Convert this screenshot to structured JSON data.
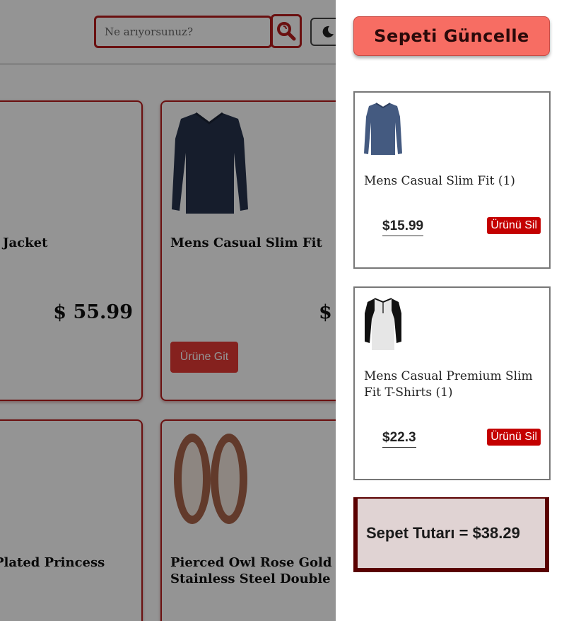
{
  "header": {
    "search_placeholder": "Ne arıyorsunuz?"
  },
  "products": [
    {
      "title": "Jacket",
      "price": "$ 55.99"
    },
    {
      "title": "Mens Casual Slim Fit",
      "price": "$",
      "button": "Ürüne Git"
    },
    {
      "title": "Plated Princess"
    },
    {
      "title": "Pierced Owl Rose Gold Plat Stainless Steel Double"
    }
  ],
  "cart": {
    "update_label": "Sepeti Güncelle",
    "items": [
      {
        "name": "Mens Casual Slim Fit (1)",
        "price": "$15.99",
        "remove": "Ürünü Sil"
      },
      {
        "name": "Mens Casual Premium Slim Fit T-Shirts (1)",
        "price": "$22.3",
        "remove": "Ürünü Sil"
      }
    ],
    "total_label": "Sepet Tutarı = $38.29"
  },
  "colors": {
    "accent": "#b71c1c",
    "update_button": "#f76d63",
    "remove_button": "#c40000",
    "total_border": "#5a0000"
  }
}
